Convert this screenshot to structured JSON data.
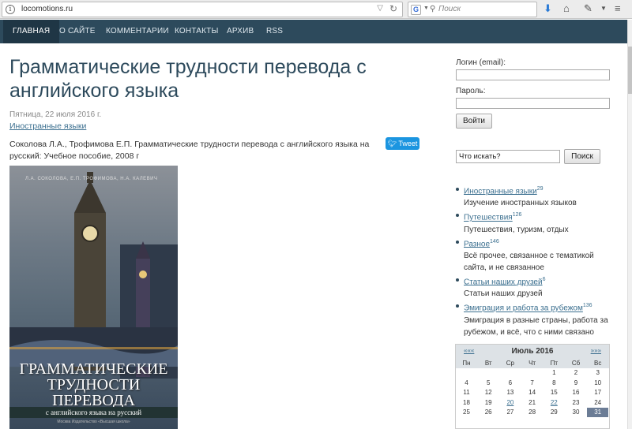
{
  "browser": {
    "url": "locomotions.ru",
    "search_placeholder": "Поиск"
  },
  "nav": {
    "items": [
      "ГЛАВНАЯ",
      "О САЙТЕ",
      "КОММЕНТАРИИ",
      "КОНТАКТЫ",
      "АРХИВ",
      "RSS"
    ]
  },
  "article": {
    "title": "Грамматические трудности перевода с английского языка",
    "date": "Пятница, 22 июля 2016 г.",
    "category": "Иностранные языки",
    "citation": "Соколова Л.А., Трофимова Е.П. Грамматические трудности перевода с английского языка на русский: Учебное пособие, 2008 г",
    "tweet_label": "Tweet"
  },
  "book": {
    "authors": "Л.А. СОКОЛОВА, Е.П. ТРОФИМОВА, Н.А. КАЛЕВИЧ",
    "title": "ГРАММАТИЧЕСКИЕ ТРУДНОСТИ ПЕРЕВОДА",
    "subtitle": "с английского языка на русский",
    "publisher": "Москва Издательство «Высшая школа»"
  },
  "login": {
    "login_label": "Логин (email):",
    "password_label": "Пароль:",
    "submit_label": "Войти"
  },
  "search": {
    "value": "Что искать?",
    "button_label": "Поиск"
  },
  "categories": [
    {
      "name": "Иностранные языки",
      "count": "29",
      "desc": "Изучение иностранных языков"
    },
    {
      "name": "Путешествия",
      "count": "126",
      "desc": "Путешествия, туризм, отдых"
    },
    {
      "name": "Разное",
      "count": "146",
      "desc": "Всё прочее, связанное с тематикой сайта, и не связанное"
    },
    {
      "name": "Статьи наших друзей",
      "count": "6",
      "desc": "Статьи наших друзей"
    },
    {
      "name": "Эмиграция и работа за рубежом",
      "count": "136",
      "desc": "Эмиграция в разные страны, работа за рубежом, и всё, что с ними связано"
    }
  ],
  "calendar": {
    "prev": "«««",
    "next": "»»»",
    "month": "Июль 2016",
    "weekdays": [
      "Пн",
      "Вт",
      "Ср",
      "Чт",
      "Пт",
      "Сб",
      "Вс"
    ],
    "weeks": [
      [
        "",
        "",
        "",
        "",
        "1",
        "2",
        "3"
      ],
      [
        "4",
        "5",
        "6",
        "7",
        "8",
        "9",
        "10"
      ],
      [
        "11",
        "12",
        "13",
        "14",
        "15",
        "16",
        "17"
      ],
      [
        "18",
        "19",
        "20",
        "21",
        "22",
        "23",
        "24"
      ],
      [
        "25",
        "26",
        "27",
        "28",
        "29",
        "30",
        "31"
      ]
    ],
    "linked_days": [
      "20",
      "22"
    ],
    "today": "31"
  },
  "colors": {
    "nav_bg": "#2d4a5c",
    "link": "#3b6f8f",
    "tweet": "#1b95e0"
  }
}
